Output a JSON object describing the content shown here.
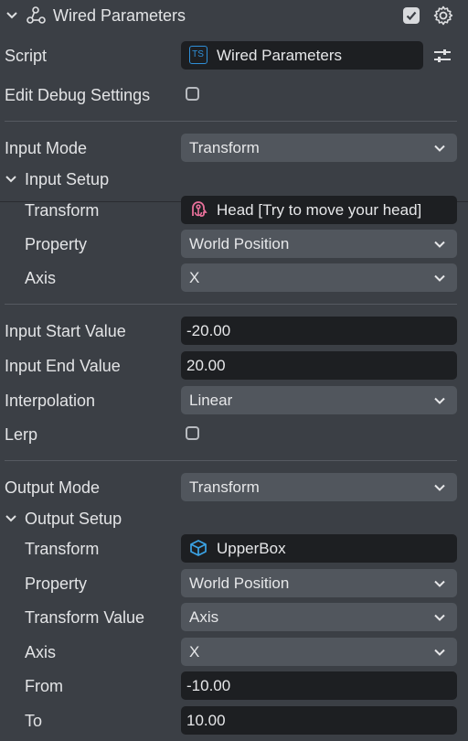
{
  "header": {
    "title": "Wired Parameters"
  },
  "script": {
    "label": "Script",
    "value": "Wired Parameters",
    "ts_badge": "TS"
  },
  "edit_debug": {
    "label": "Edit Debug Settings"
  },
  "input_mode": {
    "label": "Input Mode",
    "value": "Transform"
  },
  "input_setup": {
    "label": "Input Setup",
    "transform": {
      "label": "Transform",
      "value": "Head [Try to move your head]"
    },
    "property": {
      "label": "Property",
      "value": "World Position"
    },
    "axis": {
      "label": "Axis",
      "value": "X"
    }
  },
  "input_start": {
    "label": "Input Start Value",
    "value": "-20.00"
  },
  "input_end": {
    "label": "Input End Value",
    "value": "20.00"
  },
  "interpolation": {
    "label": "Interpolation",
    "value": "Linear"
  },
  "lerp": {
    "label": "Lerp"
  },
  "output_mode": {
    "label": "Output Mode",
    "value": "Transform"
  },
  "output_setup": {
    "label": "Output Setup",
    "transform": {
      "label": "Transform",
      "value": "UpperBox"
    },
    "property": {
      "label": "Property",
      "value": "World Position"
    },
    "transform_value": {
      "label": "Transform Value",
      "value": "Axis"
    },
    "axis": {
      "label": "Axis",
      "value": "X"
    },
    "from": {
      "label": "From",
      "value": "-10.00"
    },
    "to": {
      "label": "To",
      "value": "10.00"
    }
  },
  "colors": {
    "panel_bg": "#3b3f45",
    "dropdown_bg": "#51565d",
    "field_bg": "#1d1f22",
    "ts_blue": "#2f8fd8",
    "head_pink": "#e8709a",
    "box_blue": "#3ba4e6"
  }
}
